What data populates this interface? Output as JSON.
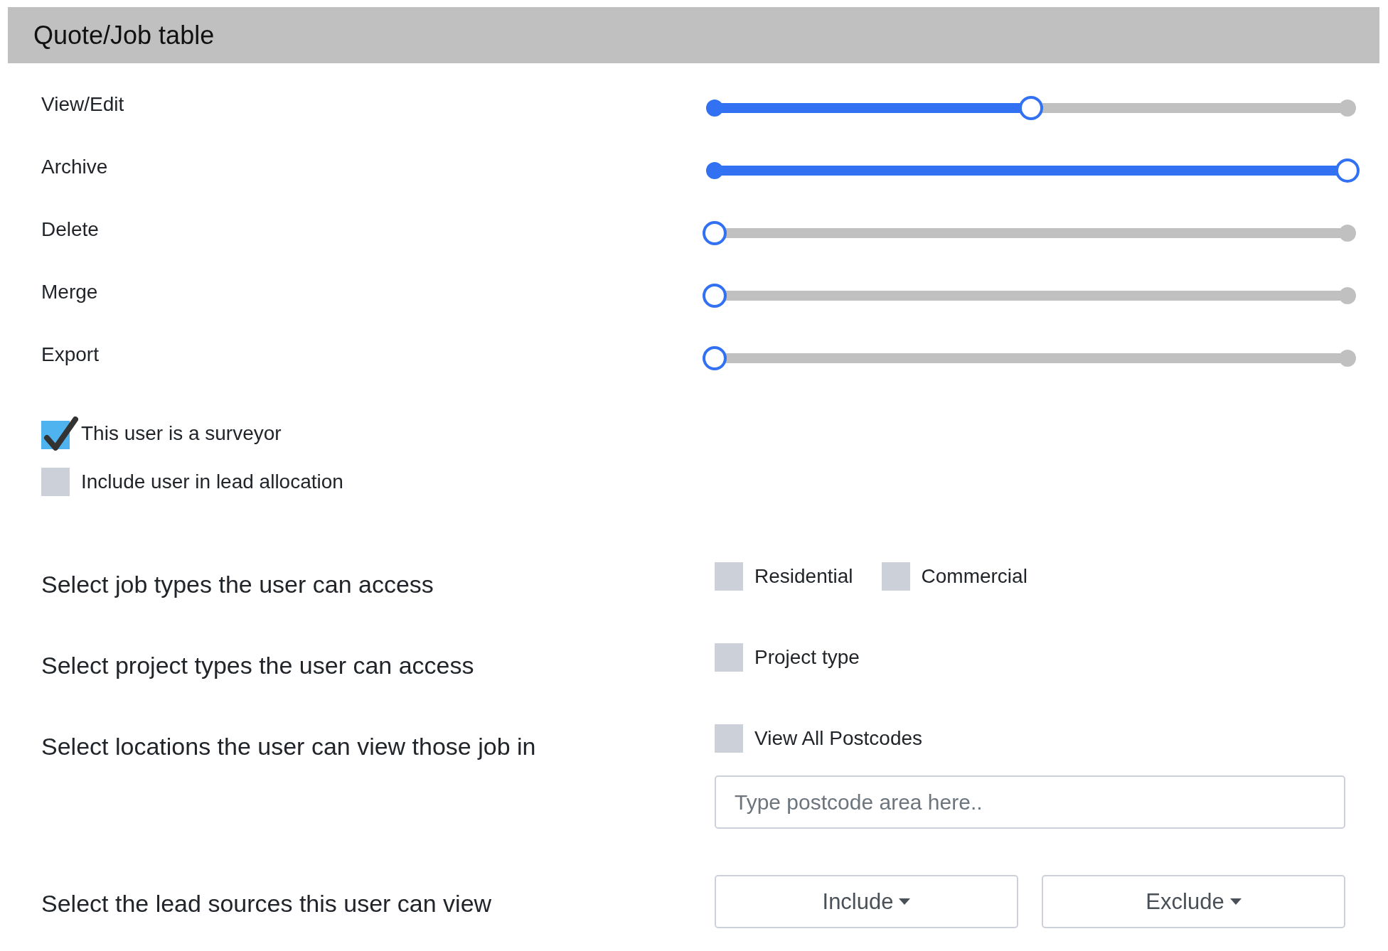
{
  "header": {
    "title": "Quote/Job table"
  },
  "permissions": [
    {
      "label": "View/Edit",
      "level": 0.5
    },
    {
      "label": "Archive",
      "level": 1
    },
    {
      "label": "Delete",
      "level": 0
    },
    {
      "label": "Merge",
      "level": 0
    },
    {
      "label": "Export",
      "level": 0
    }
  ],
  "flags": [
    {
      "label": "This user is a surveyor",
      "checked": true
    },
    {
      "label": "Include user in lead allocation",
      "checked": false
    }
  ],
  "sections": [
    {
      "title": "Select job types the user can access",
      "options": [
        {
          "label": "Residential",
          "checked": false
        },
        {
          "label": "Commercial",
          "checked": false
        }
      ]
    },
    {
      "title": "Select project types the user can access",
      "options": [
        {
          "label": "Project type",
          "checked": false
        }
      ]
    },
    {
      "title": "Select locations the user can view those job in",
      "options": [
        {
          "label": "View All Postcodes",
          "checked": false
        }
      ],
      "search": {
        "placeholder": "Type postcode area here.."
      }
    },
    {
      "title": "Select the lead sources this user can view",
      "dropdowns": [
        {
          "label": "Include"
        },
        {
          "label": "Exclude"
        }
      ]
    }
  ]
}
